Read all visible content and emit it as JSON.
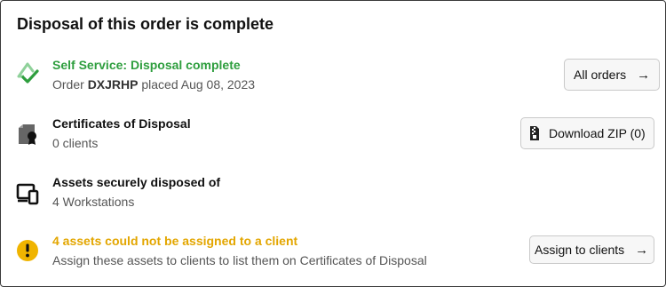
{
  "title": "Disposal of this order is complete",
  "colors": {
    "success": "#2e9e3e",
    "warning": "#e3a600",
    "icon_dark": "#222222"
  },
  "status": {
    "heading": "Self Service: Disposal complete",
    "order_prefix": "Order",
    "order_id": "DXJRHP",
    "order_suffix": "placed Aug 08, 2023",
    "button_label": "All orders",
    "icon": "recycle-check-icon"
  },
  "certificates": {
    "heading": "Certificates of Disposal",
    "sub": "0 clients",
    "button_label": "Download ZIP (0)",
    "icon": "certificate-icon",
    "button_icon": "zip-file-icon"
  },
  "assets": {
    "heading": "Assets securely disposed of",
    "sub": "4 Workstations",
    "icon": "devices-icon"
  },
  "unassigned": {
    "heading": "4 assets could not be assigned to a client",
    "sub": "Assign these assets to clients to list them on Certificates of Disposal",
    "button_label": "Assign to clients",
    "icon": "warning-icon"
  }
}
